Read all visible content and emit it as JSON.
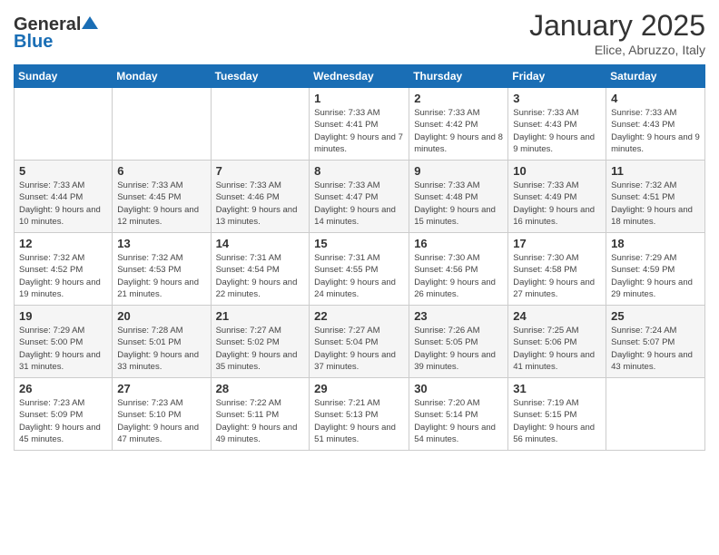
{
  "header": {
    "logo_general": "General",
    "logo_blue": "Blue",
    "month": "January 2025",
    "location": "Elice, Abruzzo, Italy"
  },
  "weekdays": [
    "Sunday",
    "Monday",
    "Tuesday",
    "Wednesday",
    "Thursday",
    "Friday",
    "Saturday"
  ],
  "weeks": [
    [
      {
        "day": "",
        "info": ""
      },
      {
        "day": "",
        "info": ""
      },
      {
        "day": "",
        "info": ""
      },
      {
        "day": "1",
        "info": "Sunrise: 7:33 AM\nSunset: 4:41 PM\nDaylight: 9 hours and 7 minutes."
      },
      {
        "day": "2",
        "info": "Sunrise: 7:33 AM\nSunset: 4:42 PM\nDaylight: 9 hours and 8 minutes."
      },
      {
        "day": "3",
        "info": "Sunrise: 7:33 AM\nSunset: 4:43 PM\nDaylight: 9 hours and 9 minutes."
      },
      {
        "day": "4",
        "info": "Sunrise: 7:33 AM\nSunset: 4:43 PM\nDaylight: 9 hours and 9 minutes."
      }
    ],
    [
      {
        "day": "5",
        "info": "Sunrise: 7:33 AM\nSunset: 4:44 PM\nDaylight: 9 hours and 10 minutes."
      },
      {
        "day": "6",
        "info": "Sunrise: 7:33 AM\nSunset: 4:45 PM\nDaylight: 9 hours and 12 minutes."
      },
      {
        "day": "7",
        "info": "Sunrise: 7:33 AM\nSunset: 4:46 PM\nDaylight: 9 hours and 13 minutes."
      },
      {
        "day": "8",
        "info": "Sunrise: 7:33 AM\nSunset: 4:47 PM\nDaylight: 9 hours and 14 minutes."
      },
      {
        "day": "9",
        "info": "Sunrise: 7:33 AM\nSunset: 4:48 PM\nDaylight: 9 hours and 15 minutes."
      },
      {
        "day": "10",
        "info": "Sunrise: 7:33 AM\nSunset: 4:49 PM\nDaylight: 9 hours and 16 minutes."
      },
      {
        "day": "11",
        "info": "Sunrise: 7:32 AM\nSunset: 4:51 PM\nDaylight: 9 hours and 18 minutes."
      }
    ],
    [
      {
        "day": "12",
        "info": "Sunrise: 7:32 AM\nSunset: 4:52 PM\nDaylight: 9 hours and 19 minutes."
      },
      {
        "day": "13",
        "info": "Sunrise: 7:32 AM\nSunset: 4:53 PM\nDaylight: 9 hours and 21 minutes."
      },
      {
        "day": "14",
        "info": "Sunrise: 7:31 AM\nSunset: 4:54 PM\nDaylight: 9 hours and 22 minutes."
      },
      {
        "day": "15",
        "info": "Sunrise: 7:31 AM\nSunset: 4:55 PM\nDaylight: 9 hours and 24 minutes."
      },
      {
        "day": "16",
        "info": "Sunrise: 7:30 AM\nSunset: 4:56 PM\nDaylight: 9 hours and 26 minutes."
      },
      {
        "day": "17",
        "info": "Sunrise: 7:30 AM\nSunset: 4:58 PM\nDaylight: 9 hours and 27 minutes."
      },
      {
        "day": "18",
        "info": "Sunrise: 7:29 AM\nSunset: 4:59 PM\nDaylight: 9 hours and 29 minutes."
      }
    ],
    [
      {
        "day": "19",
        "info": "Sunrise: 7:29 AM\nSunset: 5:00 PM\nDaylight: 9 hours and 31 minutes."
      },
      {
        "day": "20",
        "info": "Sunrise: 7:28 AM\nSunset: 5:01 PM\nDaylight: 9 hours and 33 minutes."
      },
      {
        "day": "21",
        "info": "Sunrise: 7:27 AM\nSunset: 5:02 PM\nDaylight: 9 hours and 35 minutes."
      },
      {
        "day": "22",
        "info": "Sunrise: 7:27 AM\nSunset: 5:04 PM\nDaylight: 9 hours and 37 minutes."
      },
      {
        "day": "23",
        "info": "Sunrise: 7:26 AM\nSunset: 5:05 PM\nDaylight: 9 hours and 39 minutes."
      },
      {
        "day": "24",
        "info": "Sunrise: 7:25 AM\nSunset: 5:06 PM\nDaylight: 9 hours and 41 minutes."
      },
      {
        "day": "25",
        "info": "Sunrise: 7:24 AM\nSunset: 5:07 PM\nDaylight: 9 hours and 43 minutes."
      }
    ],
    [
      {
        "day": "26",
        "info": "Sunrise: 7:23 AM\nSunset: 5:09 PM\nDaylight: 9 hours and 45 minutes."
      },
      {
        "day": "27",
        "info": "Sunrise: 7:23 AM\nSunset: 5:10 PM\nDaylight: 9 hours and 47 minutes."
      },
      {
        "day": "28",
        "info": "Sunrise: 7:22 AM\nSunset: 5:11 PM\nDaylight: 9 hours and 49 minutes."
      },
      {
        "day": "29",
        "info": "Sunrise: 7:21 AM\nSunset: 5:13 PM\nDaylight: 9 hours and 51 minutes."
      },
      {
        "day": "30",
        "info": "Sunrise: 7:20 AM\nSunset: 5:14 PM\nDaylight: 9 hours and 54 minutes."
      },
      {
        "day": "31",
        "info": "Sunrise: 7:19 AM\nSunset: 5:15 PM\nDaylight: 9 hours and 56 minutes."
      },
      {
        "day": "",
        "info": ""
      }
    ]
  ]
}
